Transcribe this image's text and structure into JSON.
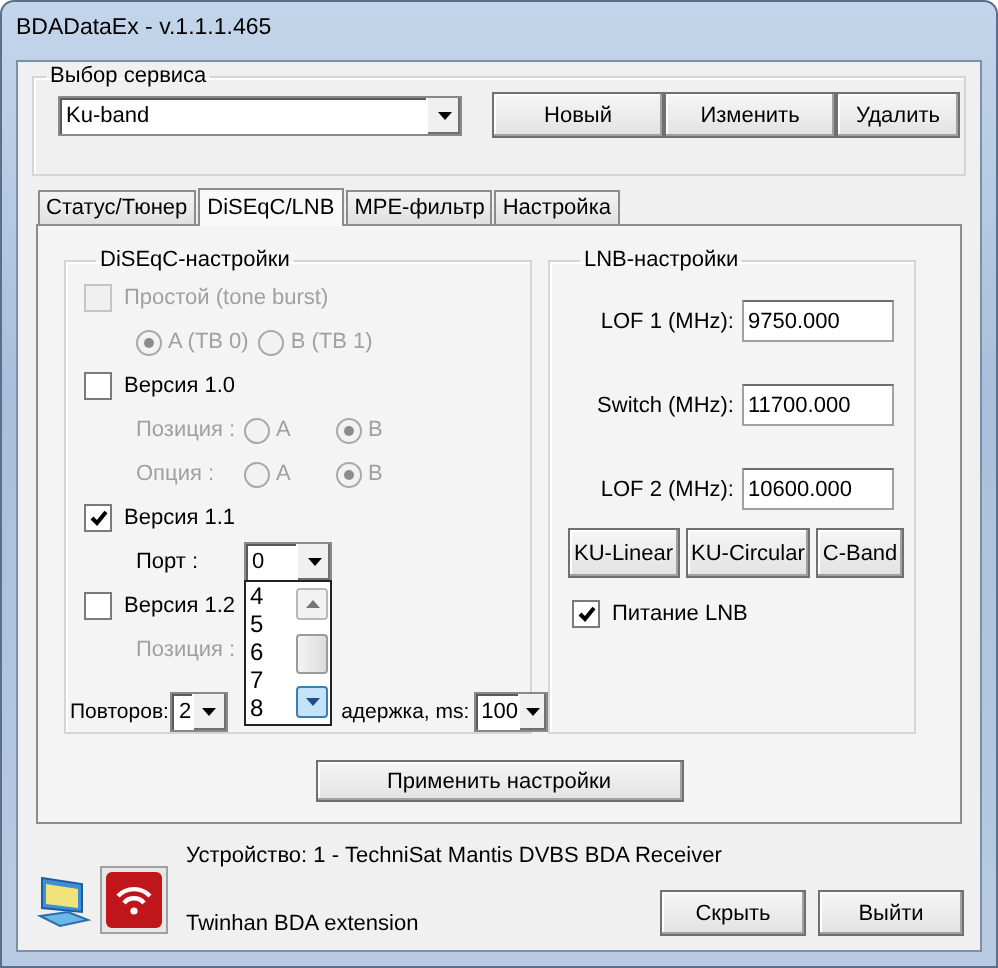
{
  "window": {
    "title": "BDADataEx - v.1.1.1.465"
  },
  "service": {
    "label": "Выбор сервиса",
    "combo": "Ku-band",
    "buttons": [
      "Новый",
      "Изменить",
      "Удалить"
    ]
  },
  "tabs": [
    {
      "label": "Статус/Тюнер",
      "selected": false
    },
    {
      "label": "DiSEqC/LNB",
      "selected": true
    },
    {
      "label": "MPE-фильтр",
      "selected": false
    },
    {
      "label": "Настройка",
      "selected": false
    }
  ],
  "diseqc": {
    "label": "DiSEqC-настройки",
    "rows": [
      {
        "kind": "checkbox",
        "label": "Простой (tone burst)",
        "checked": false,
        "disabled": true
      },
      {
        "kind": "radios",
        "disabled": true,
        "options": [
          {
            "label": "A (TB 0)",
            "selected": true
          },
          {
            "label": "B (TB 1)",
            "selected": false
          }
        ]
      },
      {
        "kind": "checkbox",
        "label": "Версия 1.0",
        "checked": false,
        "disabled": false
      },
      {
        "kind": "radios",
        "label": "Позиция :",
        "disabled": true,
        "options": [
          {
            "label": "A",
            "selected": false
          },
          {
            "label": "B",
            "selected": true
          }
        ]
      },
      {
        "kind": "radios",
        "label": "Опция :",
        "disabled": true,
        "options": [
          {
            "label": "A",
            "selected": false
          },
          {
            "label": "B",
            "selected": true
          }
        ]
      },
      {
        "kind": "checkbox",
        "label": "Версия 1.1",
        "checked": true,
        "disabled": false
      },
      {
        "kind": "combo",
        "label": "Порт :",
        "value": "0",
        "open": true,
        "list": [
          "4",
          "5",
          "6",
          "7",
          "8"
        ]
      },
      {
        "kind": "checkbox",
        "label": "Версия 1.2",
        "checked": false,
        "disabled": false
      },
      {
        "kind": "radios",
        "label": "Позиция :",
        "disabled": true
      }
    ],
    "repeats": {
      "label": "Повторов:",
      "value": "2"
    },
    "delay": {
      "label": "адержка, ms:",
      "value": "100"
    }
  },
  "lnb": {
    "label": "LNB-настройки",
    "fields": [
      {
        "label": "LOF 1 (MHz):",
        "value": "9750.000"
      },
      {
        "label": "Switch (MHz):",
        "value": "11700.000"
      },
      {
        "label": "LOF 2 (MHz):",
        "value": "10600.000"
      }
    ],
    "presets": [
      "KU-Linear",
      "KU-Circular",
      "C-Band"
    ],
    "power": {
      "label": "Питание LNB",
      "checked": true
    }
  },
  "apply_button": "Применить настройки",
  "status": {
    "device": "Устройство: 1 - TechniSat Mantis DVBS BDA Receiver",
    "extension": "Twinhan BDA extension"
  },
  "footer_buttons": [
    "Скрыть",
    "Выйти"
  ]
}
